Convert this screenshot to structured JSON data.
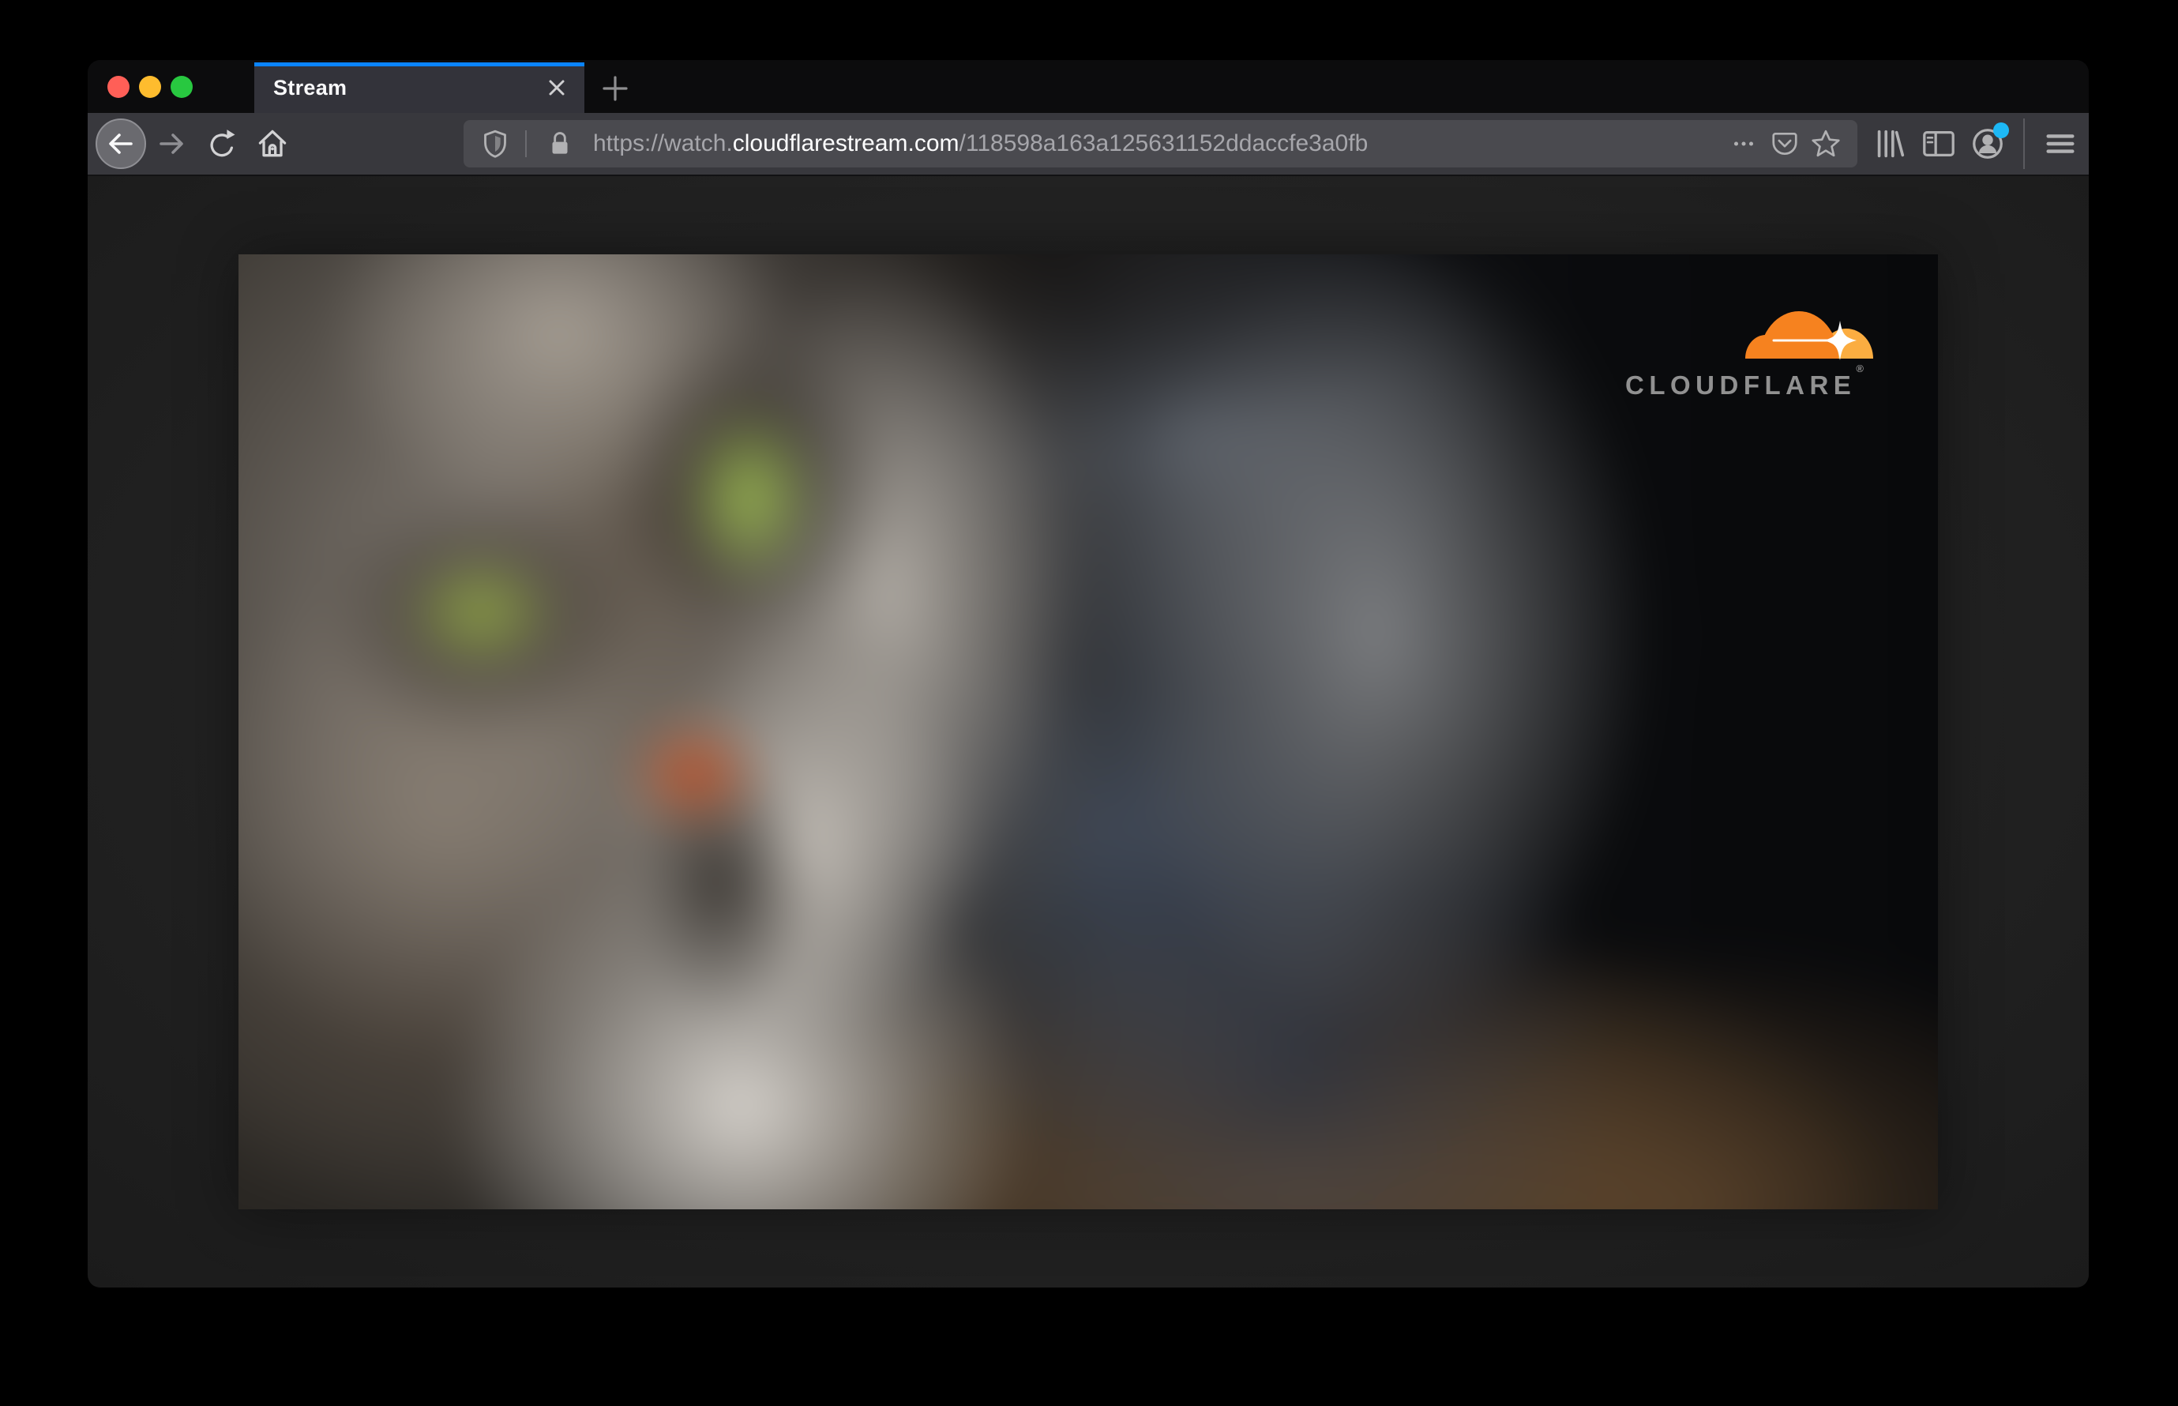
{
  "window": {
    "title": "Stream"
  },
  "tab_bar": {
    "tabs": [
      {
        "label": "Stream",
        "active": true
      }
    ]
  },
  "toolbar": {
    "url": {
      "prefix": "https://watch.",
      "domain": "cloudflarestream.com",
      "path": "/118598a163a125631152ddaccfe3a0fb"
    }
  },
  "content": {
    "video": {
      "alt": "Blurred close-up video frame of a grey tabby cat with green eyes",
      "brand_word": "CLOUDFLARE",
      "brand_mark": "®"
    }
  },
  "colors": {
    "accent_blue": "#0a84ff",
    "notification_dot": "#1db8f5",
    "cloudflare_orange": "#f6821f",
    "cloudflare_orange_light": "#fbad41",
    "traffic_red": "#ff5f57",
    "traffic_yellow": "#febc2e",
    "traffic_green": "#28c840"
  }
}
